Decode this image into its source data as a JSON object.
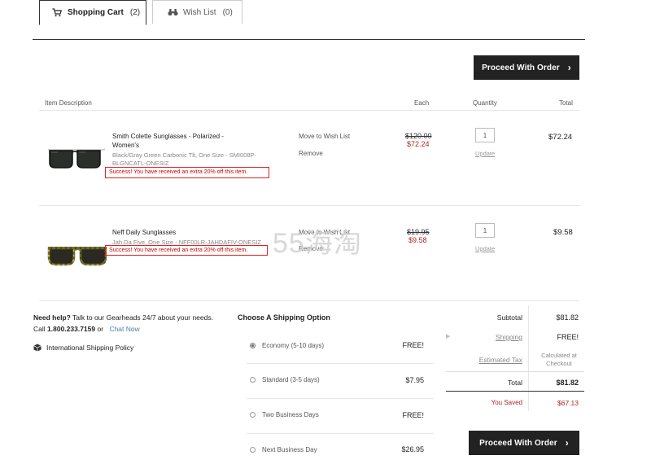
{
  "tabs": [
    {
      "label": "Shopping Cart",
      "count": "(2)"
    },
    {
      "label": "Wish List",
      "count": "(0)"
    }
  ],
  "proceed_label": "Proceed With Order",
  "columns": {
    "description": "Item Description",
    "each": "Each",
    "quantity": "Quantity",
    "total": "Total"
  },
  "items": [
    {
      "name_line1": "Smith  Colette Sunglasses - Polarized -",
      "name_line2": "Women's",
      "meta_line1": "Black/Gray Green Carbonic Tlt, One Size - SMI008P-",
      "meta_line2": "BLGNCATL-ONESIZ",
      "success": "Success! You have received an extra 20% off this item.",
      "move_label": "Move to Wish List",
      "remove_label": "Remove",
      "price_old": "$120.00",
      "price_new": "$72.24",
      "qty": "1",
      "update_label": "Update",
      "total": "$72.24"
    },
    {
      "name_line1": "Neff  Daily Sunglasses",
      "meta_line1": "Jah Da Five, One Size - NFF00LR-JAHDAFIV-ONESIZ",
      "success": "Success! You have received an extra 20% off this item.",
      "move_label": "Move to Wish List",
      "remove_label": "Remove",
      "price_old": "$19.95",
      "price_new": "$9.58",
      "qty": "1",
      "update_label": "Update",
      "total": "$9.58"
    }
  ],
  "help": {
    "need_help": "Need help?",
    "text": "Talk to our Gearheads 24/7 about your needs.",
    "call_prefix": "Call",
    "phone": "1.800.233.7159",
    "or": "or",
    "chat": "Chat Now",
    "intl_policy": "International Shipping Policy"
  },
  "shipping": {
    "title": "Choose A Shipping Option",
    "options": [
      {
        "label": "Economy (5-10 days)",
        "price": "FREE!"
      },
      {
        "label": "Standard (3-5 days)",
        "price": "$7.95"
      },
      {
        "label": "Two Business Days",
        "price": "FREE!"
      },
      {
        "label": "Next Business Day",
        "price": "$26.95"
      }
    ]
  },
  "summary": {
    "subtotal_label": "Subtotal",
    "subtotal": "$81.82",
    "shipping_label": "Shipping",
    "shipping": "FREE!",
    "tax_label": "Estimated Tax",
    "tax_line1": "Calculated at",
    "tax_line2": "Checkout",
    "total_label": "Total",
    "total": "$81.82",
    "saved_label": "You Saved",
    "saved": "$67.13"
  },
  "watermark": "55海淘",
  "colors": {
    "accent_dark": "#222222",
    "success_red": "#cc0000",
    "sale_price": "#b22222",
    "link_blue": "#4a7fa8"
  }
}
